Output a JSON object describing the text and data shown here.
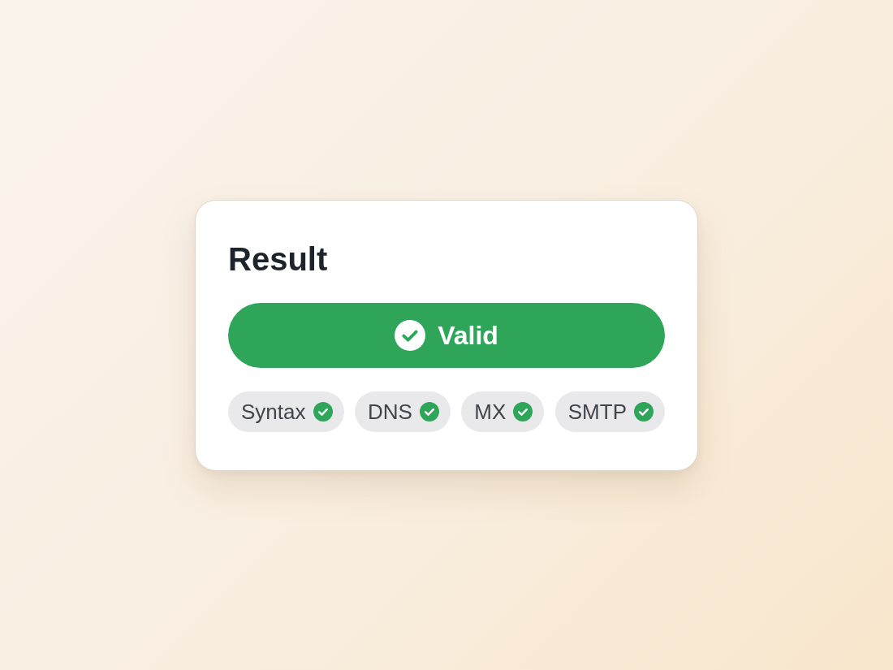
{
  "card": {
    "title": "Result",
    "status": {
      "label": "Valid",
      "valid": true
    },
    "checks": [
      {
        "label": "Syntax",
        "passed": true
      },
      {
        "label": "DNS",
        "passed": true
      },
      {
        "label": "MX",
        "passed": true
      },
      {
        "label": "SMTP",
        "passed": true
      }
    ]
  }
}
